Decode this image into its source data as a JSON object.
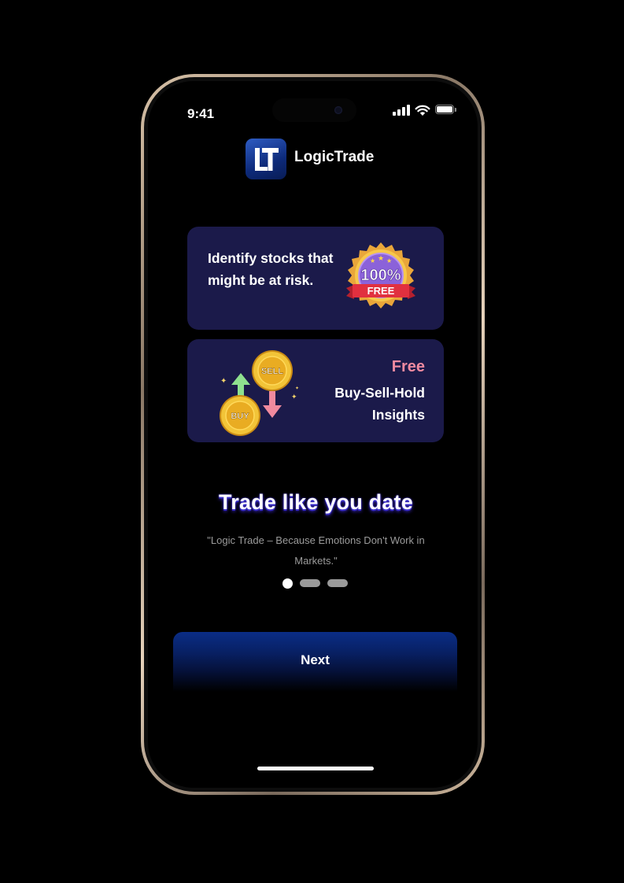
{
  "status_bar": {
    "time": "9:41"
  },
  "app": {
    "logo_initials": "LT",
    "name": "LogicTrade"
  },
  "cards": [
    {
      "text": "Identify stocks that might be at risk.",
      "badge": {
        "top": "100%",
        "bottom": "FREE"
      }
    },
    {
      "highlight": "Free",
      "text": "Buy-Sell-Hold Insights",
      "coins": {
        "sell": "SELL",
        "buy": "BUY"
      }
    }
  ],
  "headline": "Trade like you date",
  "quote": "\"Logic Trade – Because Emotions Don't Work in Markets.\"",
  "pagination": {
    "total": 3,
    "active_index": 0
  },
  "next_button": {
    "label": "Next"
  },
  "colors": {
    "card_bg": "#1b1a4a",
    "accent_blue": "#0a2d86",
    "highlight_pink": "#f08aa0",
    "headline_glow": "#3b2fc9"
  },
  "icons": [
    "signal-icon",
    "wifi-icon",
    "battery-icon",
    "free-badge-icon",
    "buy-sell-coins-icon"
  ]
}
